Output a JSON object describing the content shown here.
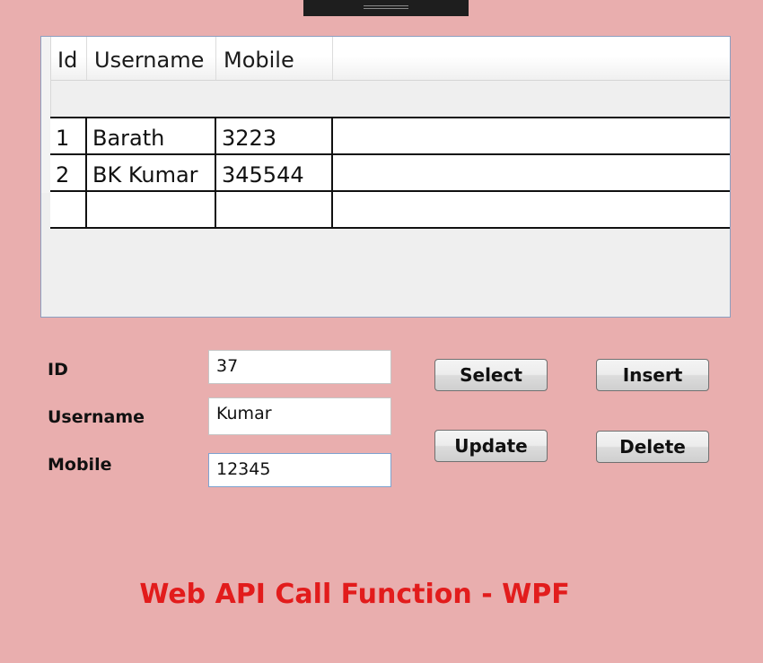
{
  "grid": {
    "columns": [
      "Id",
      "Username",
      "Mobile"
    ],
    "rows": [
      {
        "id": "1",
        "username": "Barath",
        "mobile": "3223"
      },
      {
        "id": "2",
        "username": "BK Kumar",
        "mobile": "345544"
      },
      {
        "id": "",
        "username": "",
        "mobile": ""
      }
    ]
  },
  "form": {
    "id_label": "ID",
    "id_value": "37",
    "username_label": "Username",
    "username_value": "Kumar",
    "mobile_label": "Mobile",
    "mobile_value": "12345"
  },
  "buttons": {
    "select": "Select",
    "insert": "Insert",
    "update": "Update",
    "delete": "Delete"
  },
  "footer": {
    "title": "Web API Call Function - WPF"
  },
  "colors": {
    "background": "#e9aeae",
    "title_red": "#e21c1c"
  }
}
